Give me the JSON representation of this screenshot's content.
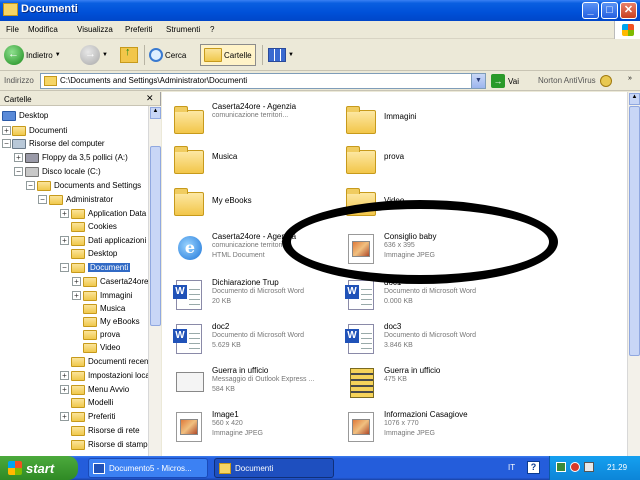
{
  "window": {
    "title": "Documenti"
  },
  "menu": [
    "File",
    "Modifica",
    "Visualizza",
    "Preferiti",
    "Strumenti",
    "?"
  ],
  "toolbar": {
    "back_label": "Indietro",
    "search_label": "Cerca",
    "folders_label": "Cartelle"
  },
  "address": {
    "label": "Indirizzo",
    "value": "C:\\Documents and Settings\\Administrator\\Documenti",
    "go_label": "Vai",
    "antivirus_label": "Norton AntiVirus"
  },
  "folders_pane": {
    "title": "Cartelle",
    "items": [
      {
        "label": "Desktop"
      },
      {
        "label": "Documenti"
      },
      {
        "label": "Risorse del computer"
      },
      {
        "label": "Floppy da 3,5 pollici (A:)"
      },
      {
        "label": "Disco locale (C:)"
      },
      {
        "label": "Documents and Settings"
      },
      {
        "label": "Administrator"
      },
      {
        "label": "Application Data"
      },
      {
        "label": "Cookies"
      },
      {
        "label": "Dati applicazioni"
      },
      {
        "label": "Desktop"
      },
      {
        "label": "Documenti"
      },
      {
        "label": "Caserta24ore"
      },
      {
        "label": "Immagini"
      },
      {
        "label": "Musica"
      },
      {
        "label": "My eBooks"
      },
      {
        "label": "prova"
      },
      {
        "label": "Video"
      },
      {
        "label": "Documenti recenti"
      },
      {
        "label": "Impostazioni locali"
      },
      {
        "label": "Menu Avvio"
      },
      {
        "label": "Modelli"
      },
      {
        "label": "Preferiti"
      },
      {
        "label": "Risorse di rete"
      },
      {
        "label": "Risorse di stampa"
      }
    ]
  },
  "files": [
    {
      "name": "Caserta24ore - Agenzia",
      "sub1": "comunicazione territori...",
      "sub2": "",
      "icon": "folder"
    },
    {
      "name": "Immagini",
      "sub1": "",
      "sub2": "",
      "icon": "folder-images"
    },
    {
      "name": "Musica",
      "sub1": "",
      "sub2": "",
      "icon": "folder-music"
    },
    {
      "name": "prova",
      "sub1": "",
      "sub2": "",
      "icon": "folder"
    },
    {
      "name": "My eBooks",
      "sub1": "",
      "sub2": "",
      "icon": "folder"
    },
    {
      "name": "Video",
      "sub1": "",
      "sub2": "",
      "icon": "folder-video"
    },
    {
      "name": "Caserta24ore - Agenzia",
      "sub1": "comunicazione territori...",
      "sub2": "HTML Document",
      "icon": "ie"
    },
    {
      "name": "Consiglio baby",
      "sub1": "636 x 395",
      "sub2": "Immagine JPEG",
      "icon": "jpeg"
    },
    {
      "name": "Dichiarazione Trup",
      "sub1": "Documento di Microsoft Word",
      "sub2": "20 KB",
      "icon": "word"
    },
    {
      "name": "doc1",
      "sub1": "Documento di Microsoft Word",
      "sub2": "0.000 KB",
      "icon": "word"
    },
    {
      "name": "doc2",
      "sub1": "Documento di Microsoft Word",
      "sub2": "5.629 KB",
      "icon": "word"
    },
    {
      "name": "doc3",
      "sub1": "Documento di Microsoft Word",
      "sub2": "3.846 KB",
      "icon": "word"
    },
    {
      "name": "Guerra in ufficio",
      "sub1": "Messaggio di Outlook Express ...",
      "sub2": "584 KB",
      "icon": "mail"
    },
    {
      "name": "Guerra in ufficio",
      "sub1": "475 KB",
      "sub2": "",
      "icon": "zip"
    },
    {
      "name": "Image1",
      "sub1": "560 x 420",
      "sub2": "Immagine JPEG",
      "icon": "jpeg"
    },
    {
      "name": "Informazioni Casagiove",
      "sub1": "1076 x 770",
      "sub2": "Immagine JPEG",
      "icon": "jpeg"
    }
  ],
  "taskbar": {
    "start_label": "start",
    "tasks": [
      {
        "label": "Documento5 - Micros..."
      },
      {
        "label": "Documenti"
      }
    ],
    "language": "IT",
    "clock": "21.29"
  }
}
